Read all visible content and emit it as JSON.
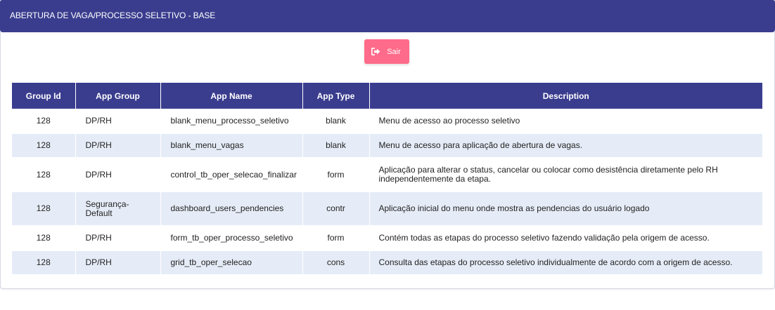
{
  "header": {
    "title": "ABERTURA DE VAGA/PROCESSO SELETIVO - BASE"
  },
  "toolbar": {
    "exit_label": "Sair",
    "exit_icon": "sign-out-icon"
  },
  "colors": {
    "header_bg": "#3a3d8e",
    "exit_button_bg": "#ff6b8a",
    "row_alt_bg": "#e6ecf7"
  },
  "table": {
    "columns": [
      "Group Id",
      "App Group",
      "App Name",
      "App Type",
      "Description"
    ],
    "rows": [
      {
        "group_id": "128",
        "app_group": "DP/RH",
        "app_name": "blank_menu_processo_seletivo",
        "app_type": "blank",
        "description": "Menu de acesso ao processo seletivo"
      },
      {
        "group_id": "128",
        "app_group": "DP/RH",
        "app_name": "blank_menu_vagas",
        "app_type": "blank",
        "description": "Menu de acesso para aplicação de abertura de vagas."
      },
      {
        "group_id": "128",
        "app_group": "DP/RH",
        "app_name": "control_tb_oper_selecao_finalizar",
        "app_type": "form",
        "description": "Aplicação para alterar o status, cancelar ou colocar como desistência diretamente pelo RH independentemente da etapa."
      },
      {
        "group_id": "128",
        "app_group": "Segurança-Default",
        "app_name": "dashboard_users_pendencies",
        "app_type": "contr",
        "description": "Aplicação inicial do menu onde mostra as pendencias do usuário logado"
      },
      {
        "group_id": "128",
        "app_group": "DP/RH",
        "app_name": "form_tb_oper_processo_seletivo",
        "app_type": "form",
        "description": "Contém todas as etapas do processo seletivo fazendo validação pela origem de acesso."
      },
      {
        "group_id": "128",
        "app_group": "DP/RH",
        "app_name": "grid_tb_oper_selecao",
        "app_type": "cons",
        "description": "Consulta das etapas do processo seletivo individualmente de acordo com a origem de acesso."
      }
    ]
  }
}
